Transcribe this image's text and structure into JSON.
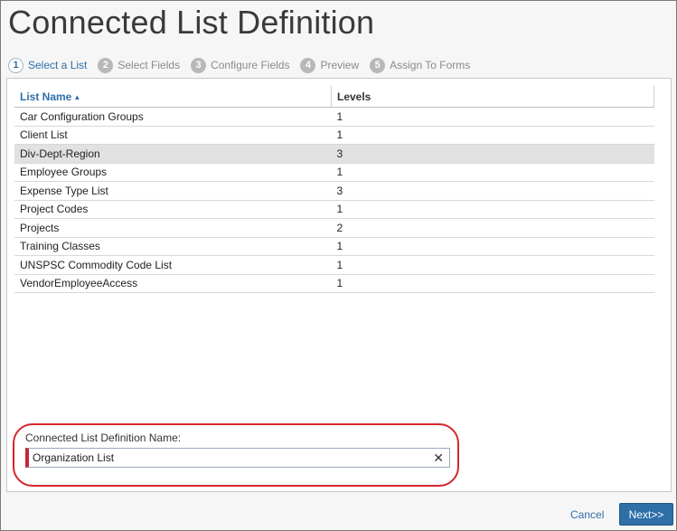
{
  "page": {
    "title": "Connected List Definition"
  },
  "steps": [
    {
      "num": "1",
      "label": "Select a List"
    },
    {
      "num": "2",
      "label": "Select Fields"
    },
    {
      "num": "3",
      "label": "Configure Fields"
    },
    {
      "num": "4",
      "label": "Preview"
    },
    {
      "num": "5",
      "label": "Assign To Forms"
    }
  ],
  "table": {
    "headers": {
      "name": "List Name",
      "levels": "Levels"
    },
    "rows": [
      {
        "name": "Car Configuration Groups",
        "levels": "1"
      },
      {
        "name": "Client List",
        "levels": "1"
      },
      {
        "name": "Div-Dept-Region",
        "levels": "3"
      },
      {
        "name": "Employee Groups",
        "levels": "1"
      },
      {
        "name": "Expense Type List",
        "levels": "3"
      },
      {
        "name": "Project Codes",
        "levels": "1"
      },
      {
        "name": "Projects",
        "levels": "2"
      },
      {
        "name": "Training Classes",
        "levels": "1"
      },
      {
        "name": "UNSPSC Commodity Code List",
        "levels": "1"
      },
      {
        "name": "VendorEmployeeAccess",
        "levels": "1"
      }
    ]
  },
  "form": {
    "name_label": "Connected List Definition Name:",
    "name_value": "Organization List"
  },
  "footer": {
    "cancel_label": "Cancel",
    "next_label": "Next>>"
  },
  "colors": {
    "accent": "#2f6fa8",
    "highlight_ring": "#d6262c",
    "selected_row": "#e1e1e1"
  },
  "icons": {
    "sort": "sort-ascending-icon",
    "clear": "clear-icon"
  }
}
